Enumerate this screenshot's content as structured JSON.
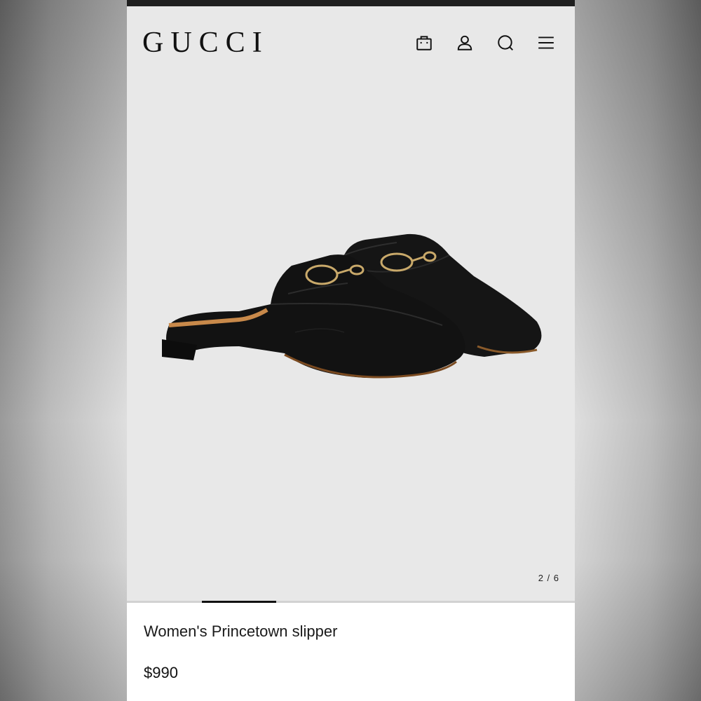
{
  "header": {
    "logo": "GUCCI",
    "icons": [
      "shopping-bag-icon",
      "account-icon",
      "search-icon",
      "menu-icon"
    ]
  },
  "gallery": {
    "counter": "2 / 6",
    "current": 2,
    "total": 6,
    "image": "black-leather-horsebit-slipper"
  },
  "product": {
    "name": "Women's Princetown slipper",
    "price": "$990"
  },
  "colors": {
    "background": "#e8e8e8",
    "text": "#111111"
  }
}
